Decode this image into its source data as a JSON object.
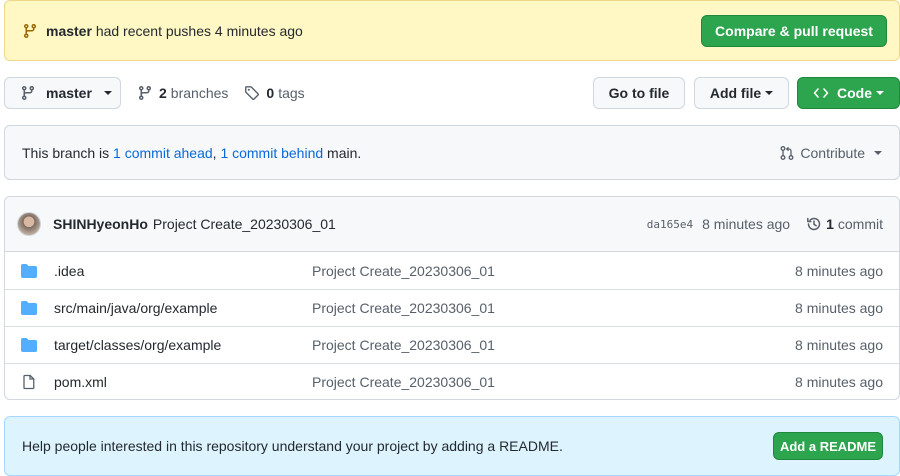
{
  "push_banner": {
    "branch": "master",
    "message": "had recent pushes 4 minutes ago",
    "button": "Compare & pull request"
  },
  "toolbar": {
    "branch_select": "master",
    "branches_count": "2",
    "branches_label": "branches",
    "tags_count": "0",
    "tags_label": "tags",
    "go_to_file": "Go to file",
    "add_file": "Add file",
    "code": "Code"
  },
  "branch_info": {
    "prefix": "This branch is",
    "ahead": "1 commit ahead",
    "sep": ",",
    "behind": "1 commit behind",
    "base": "main."
  },
  "contribute": "Contribute",
  "latest_commit": {
    "author": "SHINHyeonHo",
    "message": "Project Create_20230306_01",
    "sha": "da165e4",
    "age": "8 minutes ago",
    "count": "1",
    "count_label": "commit"
  },
  "files": [
    {
      "name": ".idea",
      "type": "folder",
      "message": "Project Create_20230306_01",
      "age": "8 minutes ago"
    },
    {
      "name": "src/main/java/org/example",
      "type": "folder",
      "message": "Project Create_20230306_01",
      "age": "8 minutes ago"
    },
    {
      "name": "target/classes/org/example",
      "type": "folder",
      "message": "Project Create_20230306_01",
      "age": "8 minutes ago"
    },
    {
      "name": "pom.xml",
      "type": "file",
      "message": "Project Create_20230306_01",
      "age": "8 minutes ago"
    }
  ],
  "readme_banner": {
    "text": "Help people interested in this repository understand your project by adding a README.",
    "button": "Add a README"
  },
  "colors": {
    "accent_green": "#2da44e",
    "link_blue": "#0969da",
    "folder_blue": "#54aeff",
    "banner_yellow": "#fff8c5",
    "banner_blue": "#ddf4ff"
  }
}
